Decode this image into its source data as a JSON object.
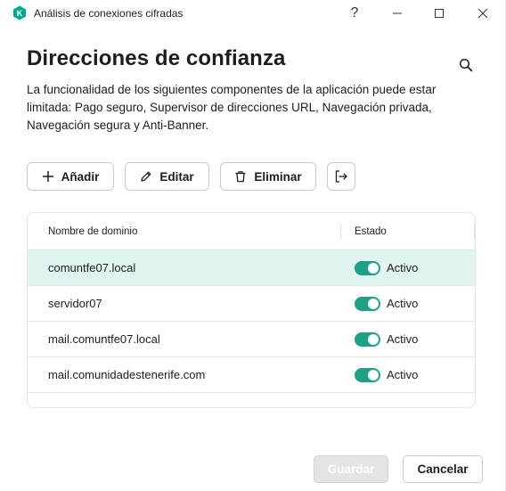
{
  "window": {
    "title": "Análisis de conexiones cifradas",
    "help_label": "?"
  },
  "page": {
    "title": "Direcciones de confianza",
    "description": "La funcionalidad de los siguientes componentes de la aplicación puede estar limitada: Pago seguro, Supervisor de direcciones URL, Navegación privada, Navegación segura y Anti-Banner."
  },
  "toolbar": {
    "add_label": "Añadir",
    "edit_label": "Editar",
    "delete_label": "Eliminar"
  },
  "table": {
    "columns": [
      "Nombre de dominio",
      "Estado"
    ],
    "rows": [
      {
        "domain": "comuntfe07.local",
        "state": "Activo",
        "enabled": true,
        "selected": true
      },
      {
        "domain": "servidor07",
        "state": "Activo",
        "enabled": true,
        "selected": false
      },
      {
        "domain": "mail.comuntfe07.local",
        "state": "Activo",
        "enabled": true,
        "selected": false
      },
      {
        "domain": "mail.comunidadestenerife.com",
        "state": "Activo",
        "enabled": true,
        "selected": false
      }
    ]
  },
  "footer": {
    "save_label": "Guardar",
    "cancel_label": "Cancelar"
  },
  "colors": {
    "accent": "#1e9f87",
    "selected_row": "#e1f5f0",
    "logo": "#00a88e"
  },
  "icons": [
    "kaspersky-logo-icon",
    "minimize-icon",
    "maximize-icon",
    "close-icon",
    "search-icon",
    "plus-icon",
    "pencil-icon",
    "trash-icon",
    "export-icon"
  ]
}
